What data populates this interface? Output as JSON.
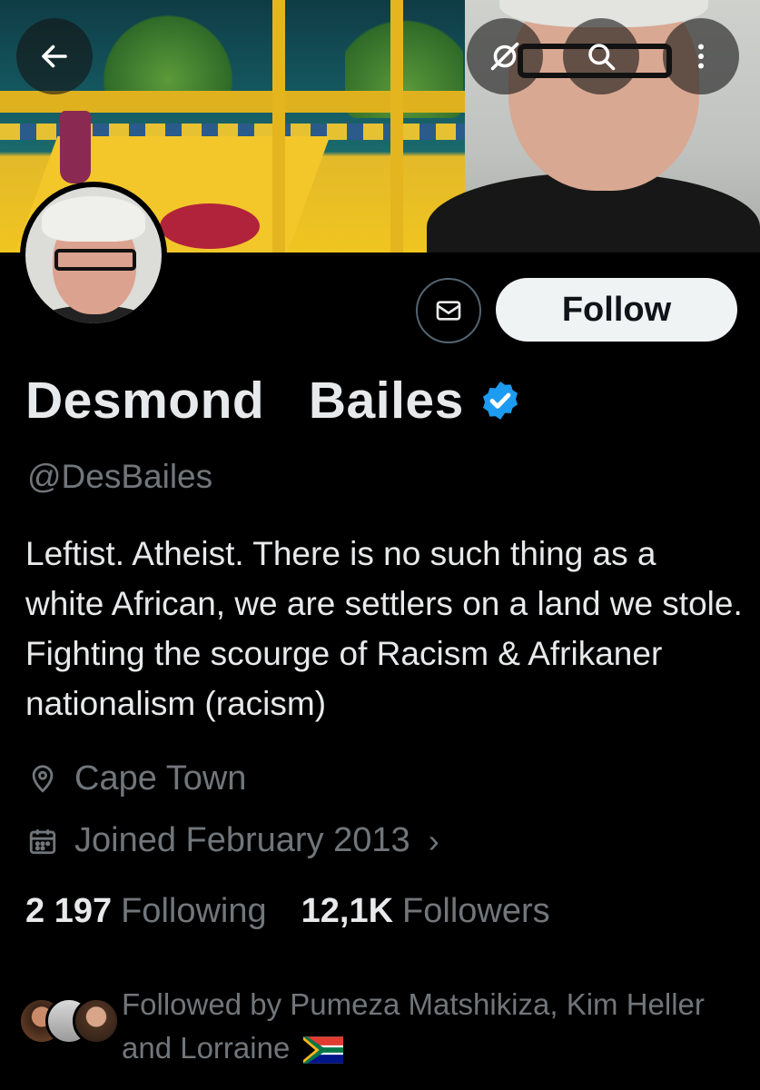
{
  "header": {
    "back_icon": "arrow-left-icon",
    "grok_icon": "grok-icon",
    "search_icon": "search-icon",
    "more_icon": "more-vertical-icon"
  },
  "profile": {
    "display_name": "Desmond  Bailes",
    "verified": true,
    "verified_color": "#1d9bf0",
    "handle": "@DesBailes",
    "bio": "Leftist. Atheist. There is no such thing as a white African, we are settlers on a land we stole. Fighting the scourge of Racism & Afrikaner nationalism (racism)",
    "location": "Cape Town",
    "joined": "Joined February 2013",
    "following_count": "2 197",
    "following_label": "Following",
    "followers_count": "12,1K",
    "followers_label": "Followers",
    "followed_by_text": "Followed by Pumeza Matshikiza, Kim Heller and Lorraine"
  },
  "actions": {
    "message_icon": "mail-icon",
    "follow_label": "Follow"
  },
  "colors": {
    "background": "#000000",
    "text_primary": "#e7e9ea",
    "text_secondary": "#71767b",
    "follow_bg": "#eff3f4"
  }
}
